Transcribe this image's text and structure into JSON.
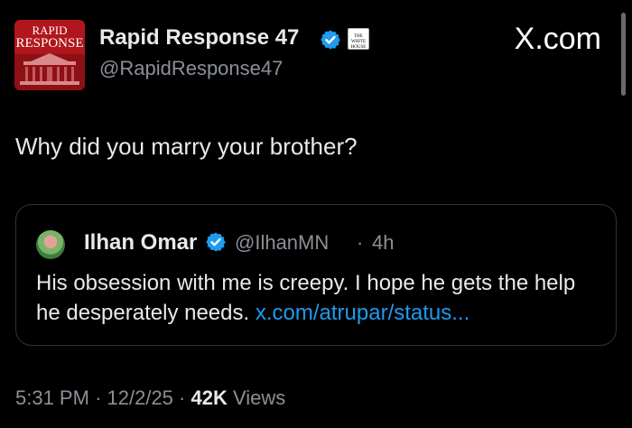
{
  "post": {
    "author": {
      "name": "Rapid Response 47",
      "handle": "@RapidResponse47",
      "avatar_text_line1": "RAPID",
      "avatar_text_line2": "RESPONSE",
      "verified_icon": "verified-badge-icon",
      "affiliate_text": "THE WHITE HOUSE",
      "affiliate_icon": "white-house-seal-icon"
    },
    "site_label": "X.com",
    "text": "Why did you marry your brother?",
    "quote": {
      "author_name": "Ilhan Omar",
      "handle": "@IlhanMN",
      "separator": "·",
      "time": "4h",
      "text": "His obsession with me is creepy. I hope he gets the help he desperately needs. ",
      "link": "x.com/atrupar/status..."
    },
    "meta": {
      "time": "5:31 PM",
      "date": "12/2/25",
      "separator": "·",
      "views_count": "42K",
      "views_label": "Views"
    }
  },
  "colors": {
    "background": "#000000",
    "text": "#e7e9ea",
    "secondary": "#8b9097",
    "link": "#1d9bf0",
    "verified": "#1d9bf0",
    "avatar_bg": "#b0161c"
  }
}
